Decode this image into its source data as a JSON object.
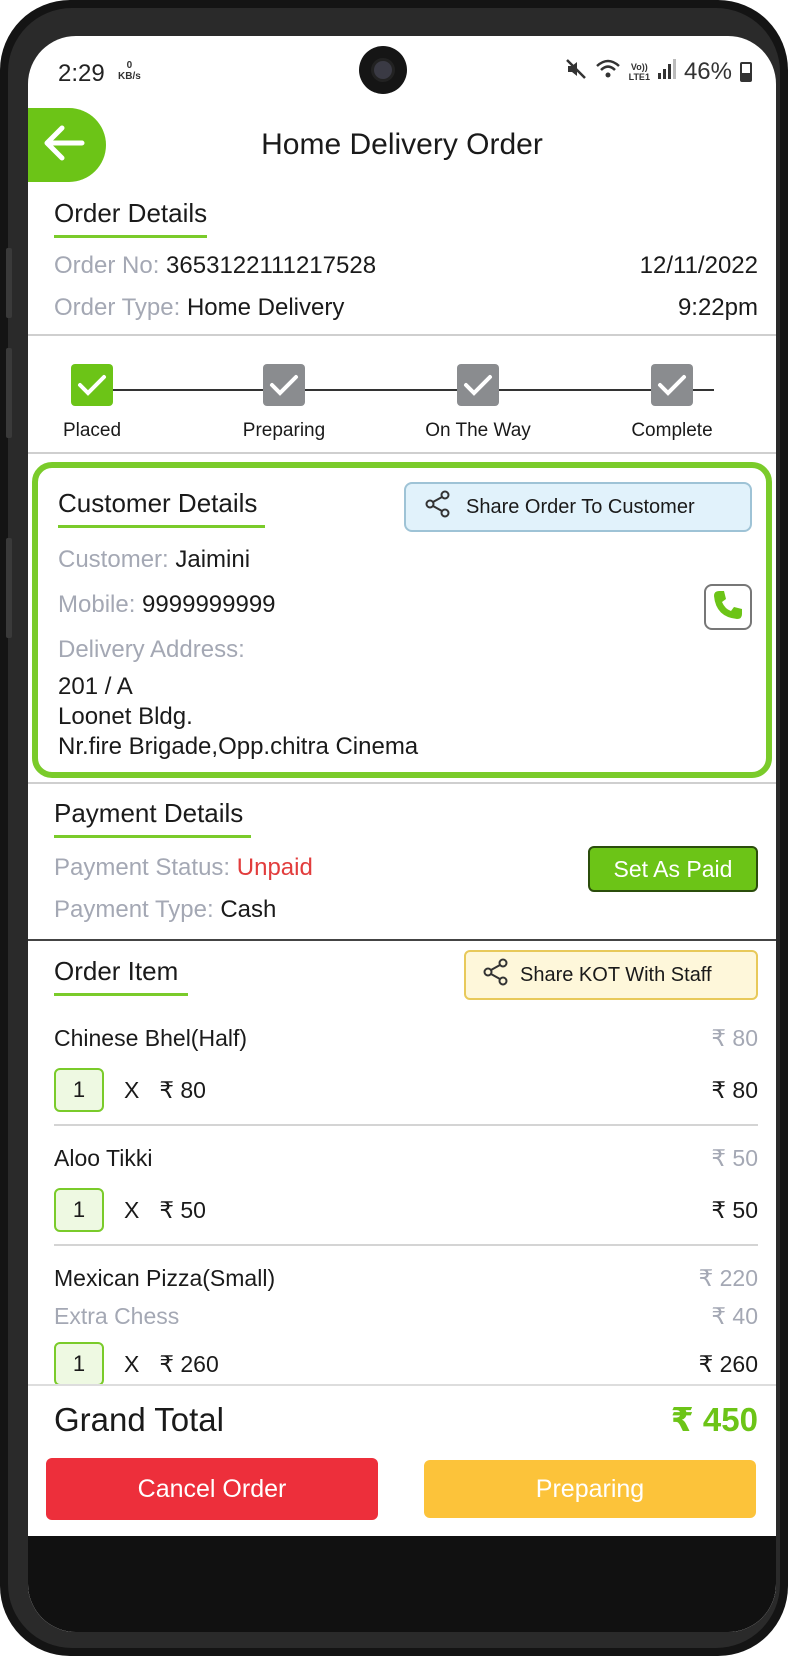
{
  "status_bar": {
    "time": "2:29",
    "speed_value": "0",
    "speed_unit": "KB/s",
    "network_top": "Vo))",
    "network_bottom": "LTE1",
    "battery": "46%"
  },
  "header": {
    "title": "Home Delivery Order"
  },
  "order_details": {
    "title": "Order Details",
    "order_no_label": "Order No:",
    "order_no": "3653122111217528",
    "date": "12/11/2022",
    "order_type_label": "Order Type:",
    "order_type": "Home Delivery",
    "time": "9:22pm"
  },
  "progress": {
    "steps": [
      {
        "label": "Placed",
        "done": true
      },
      {
        "label": "Preparing",
        "done": false
      },
      {
        "label": "On The Way",
        "done": false
      },
      {
        "label": "Complete",
        "done": false
      }
    ]
  },
  "customer": {
    "title": "Customer Details",
    "share_label": "Share Order To Customer",
    "customer_label": "Customer:",
    "customer_name": "Jaimini",
    "mobile_label": "Mobile:",
    "mobile": "9999999999",
    "address_label": "Delivery Address:",
    "address_lines": [
      "201 / A",
      "Loonet Bldg.",
      "Nr.fire Brigade,Opp.chitra Cinema"
    ]
  },
  "payment": {
    "title": "Payment Details",
    "status_label": "Payment Status:",
    "status": "Unpaid",
    "type_label": "Payment Type:",
    "type": "Cash",
    "set_paid_label": "Set As Paid"
  },
  "order_items": {
    "title": "Order Item",
    "share_kot_label": "Share KOT With Staff",
    "items": [
      {
        "name": "Chinese Bhel(Half)",
        "price": "₹ 80",
        "extras": [],
        "qty": "1",
        "x": "X",
        "unit_price": "₹ 80",
        "total": "₹ 80"
      },
      {
        "name": "Aloo Tikki",
        "price": "₹ 50",
        "extras": [],
        "qty": "1",
        "x": "X",
        "unit_price": "₹ 50",
        "total": "₹ 50"
      },
      {
        "name": "Mexican Pizza(Small)",
        "price": "₹ 220",
        "extras": [
          {
            "name": "Extra Chess",
            "price": "₹ 40"
          }
        ],
        "qty": "1",
        "x": "X",
        "unit_price": "₹ 260",
        "total": "₹ 260"
      }
    ]
  },
  "footer": {
    "grand_total_label": "Grand Total",
    "grand_total": "₹ 450",
    "cancel_label": "Cancel Order",
    "preparing_label": "Preparing"
  },
  "colors": {
    "accent_green": "#6cc417",
    "cancel_red": "#ed2f3b",
    "preparing_yellow": "#fcc33a",
    "unpaid_red": "#e23c3c"
  }
}
